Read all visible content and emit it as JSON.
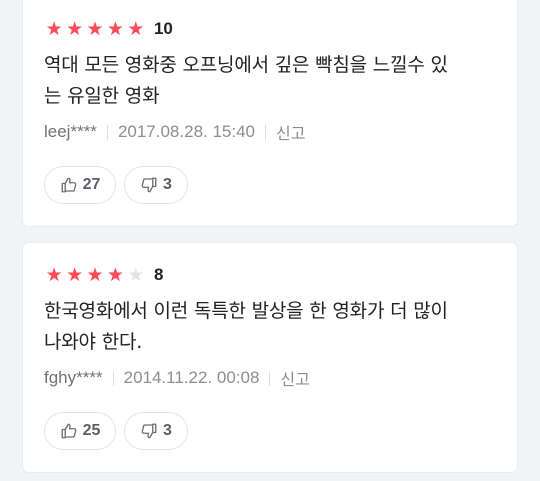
{
  "reviews": [
    {
      "stars": 5,
      "score": "10",
      "text_line1": "역대 모든 영화중 오프닝에서 깊은 빡침을 느낄수 있",
      "text_line2": "는 유일한 영화",
      "user": "leej****",
      "date": "2017.08.28. 15:40",
      "report_label": "신고",
      "likes": "27",
      "dislikes": "3"
    },
    {
      "stars": 4,
      "score": "8",
      "text_line1": "한국영화에서 이런 독특한 발상을 한 영화가 더 많이",
      "text_line2": "나와야 한다.",
      "user": "fghy****",
      "date": "2014.11.22. 00:08",
      "report_label": "신고",
      "likes": "25",
      "dislikes": "3"
    }
  ],
  "icons": {
    "like": "thumbs-up-icon",
    "dislike": "thumbs-down-icon",
    "star": "star-icon"
  },
  "colors": {
    "star_on": "#ff4a57",
    "star_off": "#e2e4e8"
  }
}
